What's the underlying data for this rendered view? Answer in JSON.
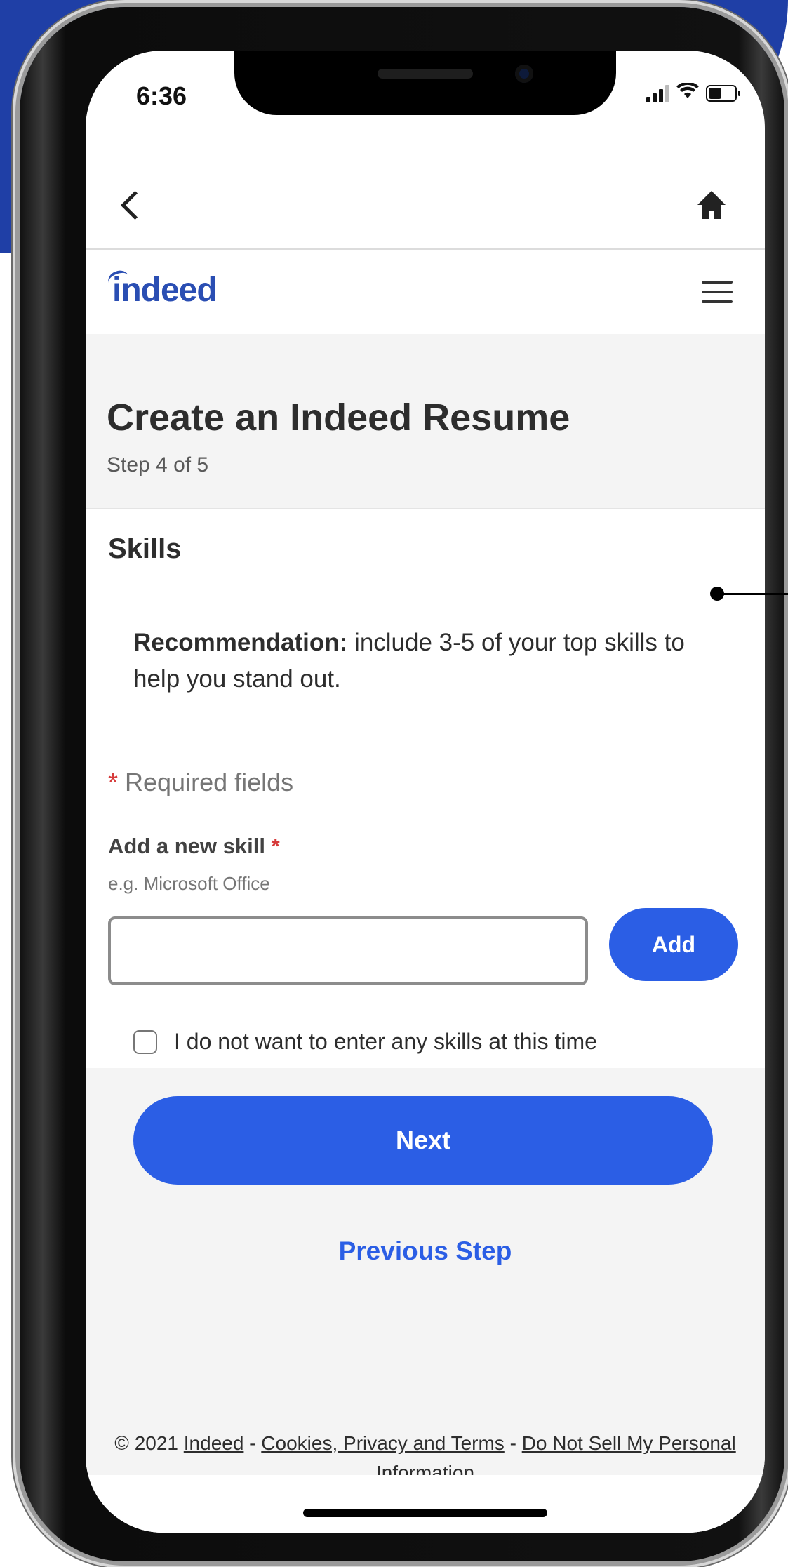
{
  "status_bar": {
    "time": "6:36"
  },
  "header": {
    "logo_text": "indeed"
  },
  "page": {
    "title": "Create an Indeed Resume",
    "step": "Step 4 of 5"
  },
  "skills": {
    "heading": "Skills",
    "recommendation_label": "Recommendation:",
    "recommendation_text": " include 3-5 of your top skills to help you stand out.",
    "required_marker": "*",
    "required_text": " Required fields",
    "field_label": "Add a new skill",
    "field_hint": "e.g. Microsoft Office",
    "input_value": "",
    "add_button": "Add",
    "checkbox_label": "I do not want to enter any skills at this time",
    "checkbox_checked": false
  },
  "actions": {
    "next": "Next",
    "previous": "Previous Step"
  },
  "footer": {
    "copyright": "© 2021 ",
    "link_indeed": "Indeed",
    "sep1": " - ",
    "link_terms": "Cookies, Privacy and Terms",
    "sep2": " - ",
    "link_dns": "Do Not Sell My Personal Information"
  },
  "colors": {
    "brand_blue": "#2b5ee5",
    "logo_blue": "#2a4eb3",
    "background_blue": "#1f3fa6",
    "required_red": "#d63a3a"
  },
  "icons": [
    "back-chevron-icon",
    "home-icon",
    "hamburger-menu-icon",
    "signal-icon",
    "wifi-icon",
    "battery-icon"
  ]
}
